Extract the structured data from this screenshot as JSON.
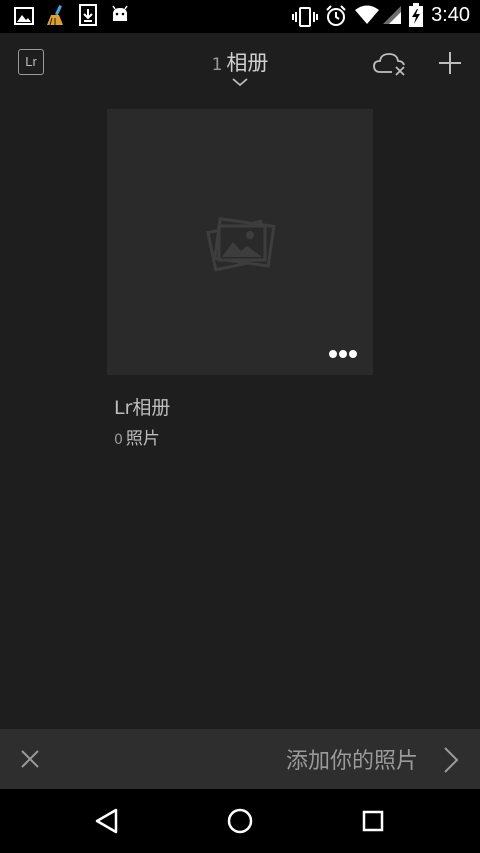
{
  "status_bar": {
    "time": "3:40",
    "left_icons": [
      "gallery-icon",
      "cleaner-icon",
      "download-icon",
      "android-icon"
    ],
    "right_icons": [
      "vibrate-icon",
      "alarm-icon",
      "wifi-icon",
      "signal-icon",
      "battery-icon"
    ]
  },
  "header": {
    "logo_text": "Lr",
    "album_count": "1",
    "album_label": "相册"
  },
  "album": {
    "name": "Lr相册",
    "photo_count": "0",
    "photo_label": "照片"
  },
  "banner": {
    "text": "添加你的照片"
  },
  "colors": {
    "background": "#1e1e1e",
    "card": "#2a2a2a",
    "banner": "#2e2e2e",
    "bars": "#000000"
  }
}
